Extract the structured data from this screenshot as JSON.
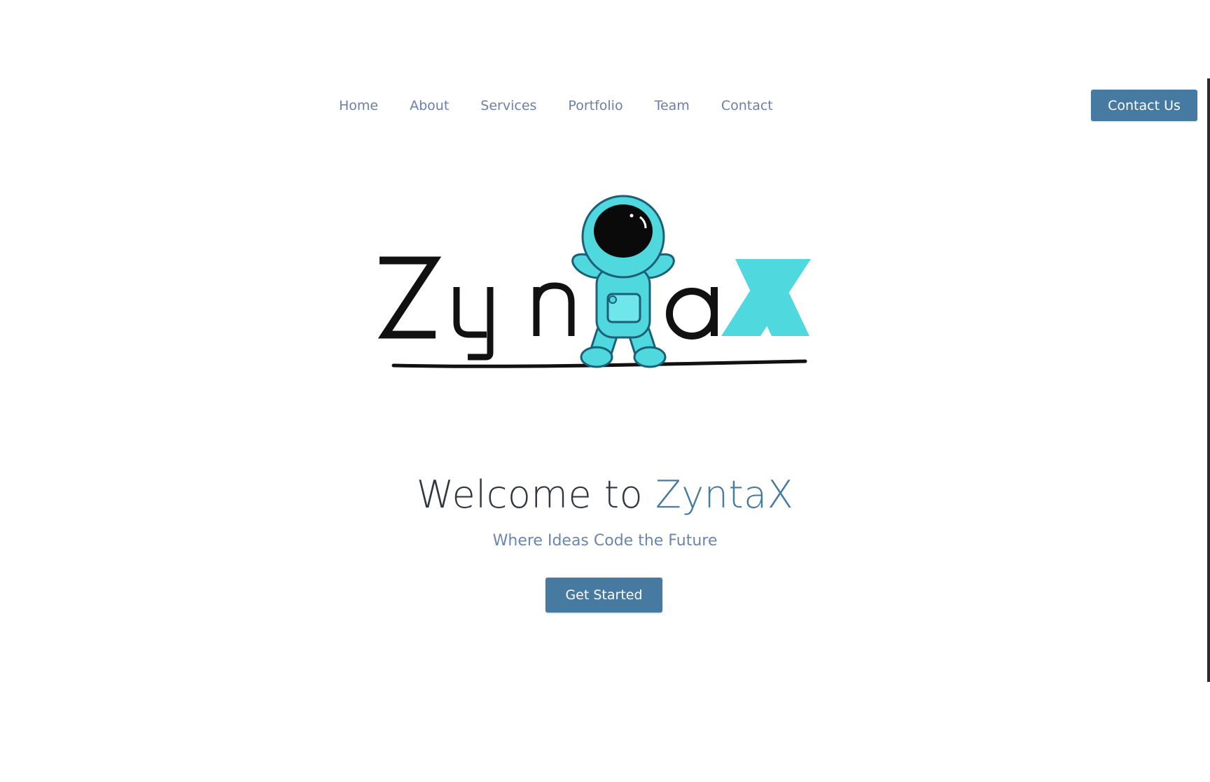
{
  "nav": {
    "items": [
      {
        "label": "Home"
      },
      {
        "label": "About"
      },
      {
        "label": "Services"
      },
      {
        "label": "Portfolio"
      },
      {
        "label": "Team"
      },
      {
        "label": "Contact"
      }
    ],
    "cta_label": "Contact Us"
  },
  "logo": {
    "wordmark": "ZyntaX",
    "icon": "astronaut-icon"
  },
  "hero": {
    "title_prefix": "Welcome to ",
    "title_brand": "ZyntaX",
    "subtitle": "Where Ideas Code the Future",
    "cta_label": "Get Started"
  },
  "colors": {
    "accent": "#477aa0",
    "nav_text": "#6b7fa8",
    "logo_cyan": "#4fd8de",
    "logo_purple": "#8a5ad6",
    "title_text": "#2f3640"
  }
}
